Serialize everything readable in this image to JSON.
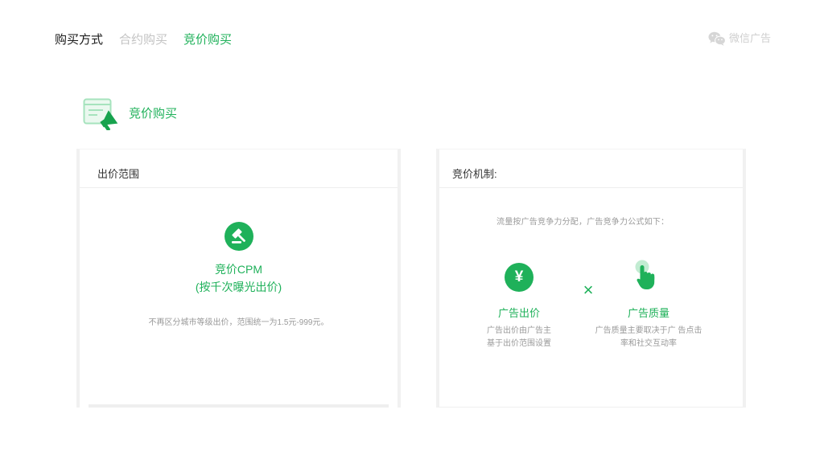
{
  "nav": {
    "title": "购买方式",
    "tabs": [
      {
        "label": "合约购买",
        "active": false
      },
      {
        "label": "竞价购买",
        "active": true
      }
    ]
  },
  "brand": {
    "icon": "wechat-icon",
    "label": "微信广告"
  },
  "section": {
    "icon": "bidding-card-icon",
    "title": "竞价购买"
  },
  "bid_range_card": {
    "title": "出价范围",
    "icon": "gavel-icon",
    "headline": "竞价CPM",
    "subheadline": "(按千次曝光出价)",
    "note": "不再区分城市等级出价，范围统一为1.5元-999元。"
  },
  "mechanism_card": {
    "title": "竞价机制:",
    "intro": "流量按广告竞争力分配，广告竞争力公式如下：",
    "operator": "×",
    "factors": [
      {
        "icon": "yuan-icon",
        "symbol": "¥",
        "title": "广告出价",
        "desc_lines": [
          "广告出价由广告主",
          "基于出价范围设置"
        ]
      },
      {
        "icon": "tap-hand-icon",
        "title": "广告质量",
        "desc_lines": [
          "广告质量主要取决于广 告点击",
          "率和社交互动率"
        ]
      }
    ]
  },
  "colors": {
    "accent": "#1fb15a",
    "accent_dark": "#17a34e",
    "accent_light": "#c2ecd2",
    "muted_tab": "#c3c3c3",
    "brand_gray": "#cfcfcf",
    "caption_gray": "#9a9a9a"
  }
}
